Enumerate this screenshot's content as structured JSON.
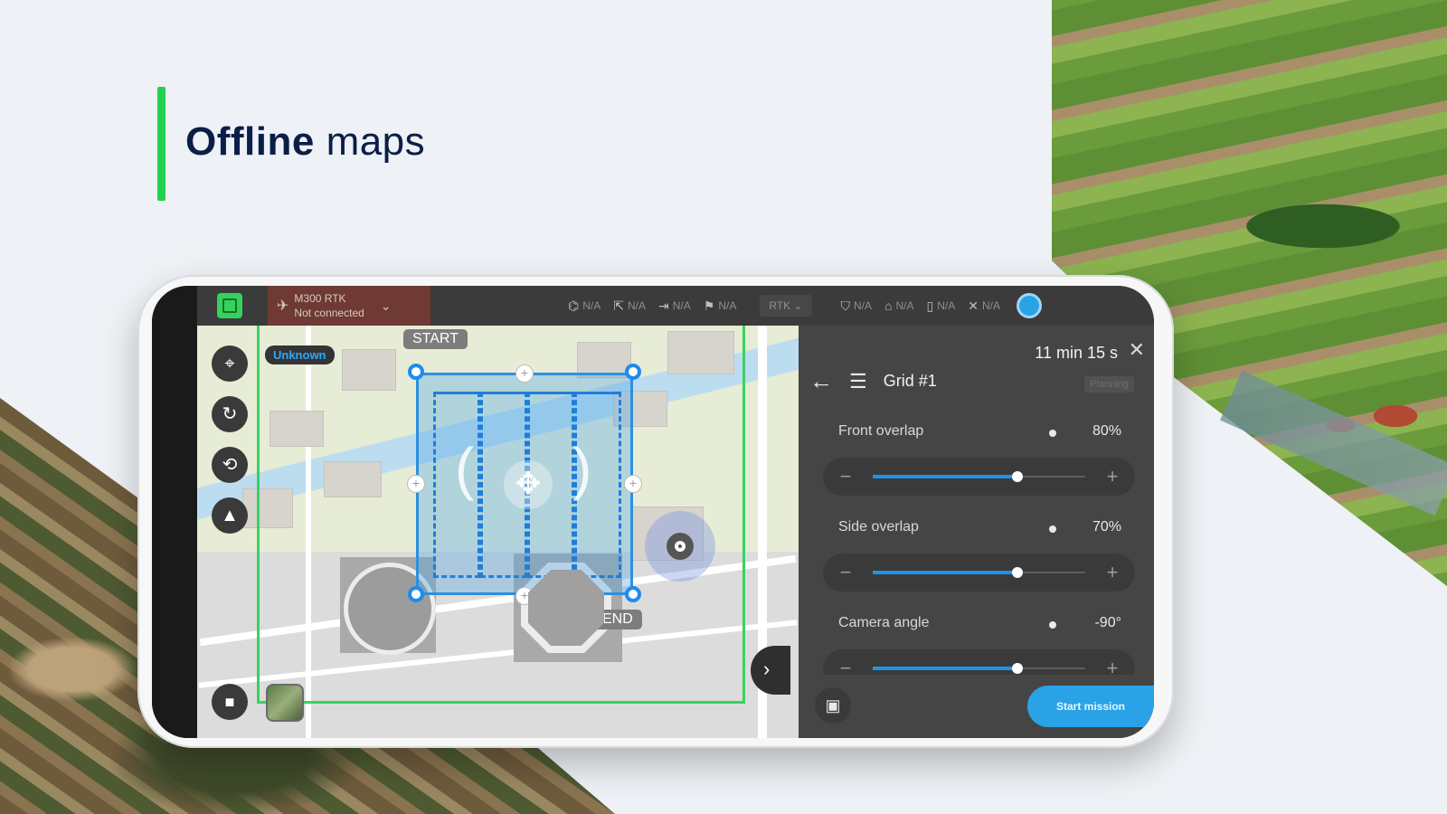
{
  "headline": {
    "bold": "Offline",
    "light": "maps"
  },
  "topbar": {
    "drone_model": "M300 RTK",
    "drone_status": "Not connected",
    "stats_left": [
      "N/A",
      "N/A",
      "N/A",
      "N/A"
    ],
    "rtk_label": "RTK",
    "stats_right": [
      "N/A",
      "N/A",
      "N/A",
      "N/A"
    ]
  },
  "map": {
    "unknown_label": "Unknown",
    "start_label": "START",
    "end_label": "END"
  },
  "panel": {
    "time": "11 min 15 s",
    "title": "Grid #1",
    "status_badge": "Planning",
    "params": [
      {
        "name": "Front overlap",
        "value": "80%",
        "fraction": 0.68
      },
      {
        "name": "Side overlap",
        "value": "70%",
        "fraction": 0.68
      },
      {
        "name": "Camera angle",
        "value": "-90°",
        "fraction": 0.68
      }
    ],
    "start_button": "Start mission"
  },
  "colors": {
    "accent_green": "#22d24f",
    "headline_navy": "#0b1e47",
    "primary_blue": "#2aa3e6",
    "grid_blue": "#2e8fe0",
    "frame_green": "#3ad25f",
    "disconnected_red": "#6e3a33"
  },
  "icons": [
    "app-logo-icon",
    "drone-icon",
    "chevron-down-icon",
    "satellite-icon",
    "signal-icon",
    "battery-icon",
    "gps-icon",
    "locate-icon",
    "rotate-icon",
    "reset-icon",
    "compass-icon",
    "camera-icon",
    "map-thumb-icon",
    "chevron-right-icon",
    "close-icon",
    "back-arrow-icon",
    "grid-mission-icon",
    "save-icon",
    "move-icon"
  ]
}
